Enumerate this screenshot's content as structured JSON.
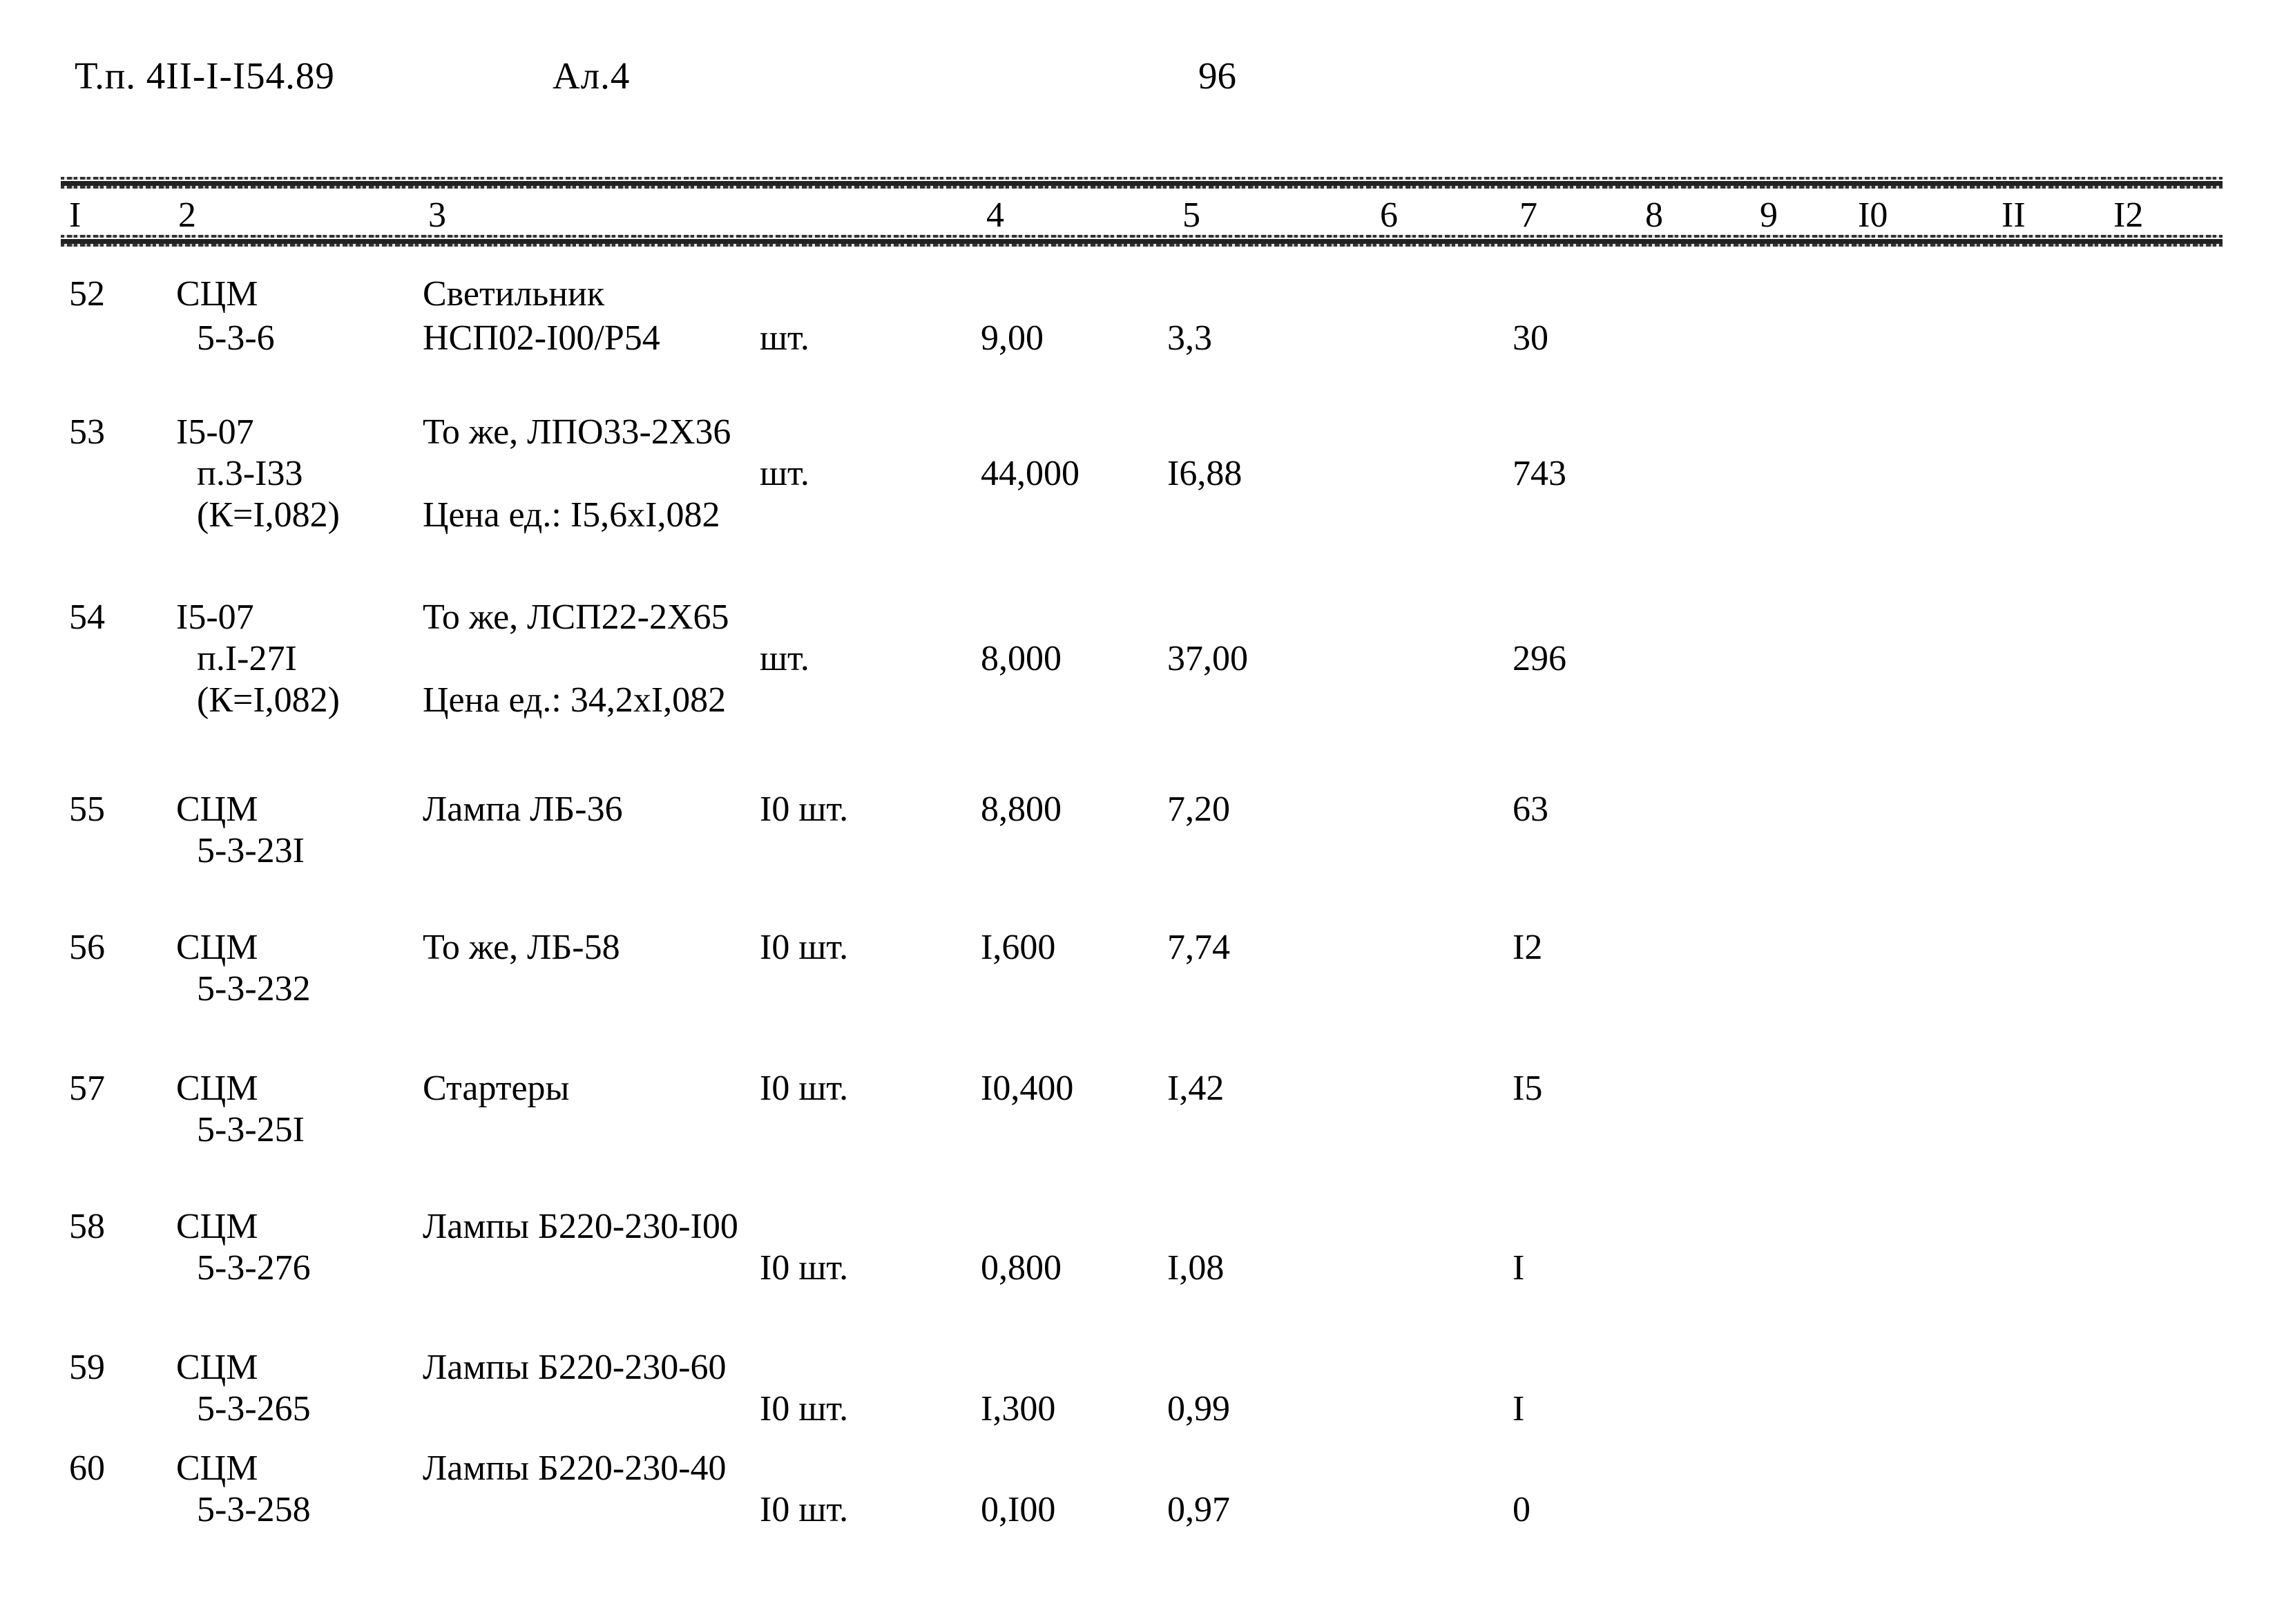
{
  "header": {
    "doc_code": "Т.п. 4II-I-I54.89",
    "album": "Ал.4",
    "page_number": "96"
  },
  "table": {
    "column_headers": [
      "I",
      "2",
      "3",
      "4",
      "5",
      "6",
      "7",
      "8",
      "9",
      "I0",
      "II",
      "I2"
    ],
    "rows": [
      {
        "num": "52",
        "code_line1": "СЦМ",
        "code_line2": "5-3-6",
        "code_line3": "",
        "name_line1": "Светильник",
        "name_line2": "НСП02-I00/Р54",
        "name_line3": "",
        "unit": "шт.",
        "qty": "9,00",
        "price": "3,3",
        "total": "30"
      },
      {
        "num": "53",
        "code_line1": "I5-07",
        "code_line2": "п.3-I33",
        "code_line3": "(К=I,082)",
        "name_line1": "То же, ЛПО33-2Х36",
        "name_line2": "",
        "name_line3": "Цена ед.: I5,6хI,082",
        "unit": "шт.",
        "qty": "44,000",
        "price": "I6,88",
        "total": "743"
      },
      {
        "num": "54",
        "code_line1": "I5-07",
        "code_line2": "п.I-27I",
        "code_line3": "(К=I,082)",
        "name_line1": "То же, ЛСП22-2Х65",
        "name_line2": "",
        "name_line3": "Цена ед.: 34,2хI,082",
        "unit": "шт.",
        "qty": "8,000",
        "price": "37,00",
        "total": "296"
      },
      {
        "num": "55",
        "code_line1": "СЦМ",
        "code_line2": "5-3-23I",
        "code_line3": "",
        "name_line1": "Лампа ЛБ-36",
        "name_line2": "",
        "name_line3": "",
        "unit": "I0 шт.",
        "qty": "8,800",
        "price": "7,20",
        "total": "63"
      },
      {
        "num": "56",
        "code_line1": "СЦМ",
        "code_line2": "5-3-232",
        "code_line3": "",
        "name_line1": "То же, ЛБ-58",
        "name_line2": "",
        "name_line3": "",
        "unit": "I0 шт.",
        "qty": "I,600",
        "price": "7,74",
        "total": "I2"
      },
      {
        "num": "57",
        "code_line1": "СЦМ",
        "code_line2": "5-3-25I",
        "code_line3": "",
        "name_line1": "Стартеры",
        "name_line2": "",
        "name_line3": "",
        "unit": "I0 шт.",
        "qty": "I0,400",
        "price": "I,42",
        "total": "I5"
      },
      {
        "num": "58",
        "code_line1": "СЦМ",
        "code_line2": "5-3-276",
        "code_line3": "",
        "name_line1": "Лампы Б220-230-I00",
        "name_line2": "",
        "name_line3": "",
        "unit": "I0 шт.",
        "qty": "0,800",
        "price": "I,08",
        "total": "I"
      },
      {
        "num": "59",
        "code_line1": "СЦМ",
        "code_line2": "5-3-265",
        "code_line3": "",
        "name_line1": "Лампы Б220-230-60",
        "name_line2": "",
        "name_line3": "",
        "unit": "I0 шт.",
        "qty": "I,300",
        "price": "0,99",
        "total": "I"
      },
      {
        "num": "60",
        "code_line1": "СЦМ",
        "code_line2": "5-3-258",
        "code_line3": "",
        "name_line1": "Лампы Б220-230-40",
        "name_line2": "",
        "name_line3": "",
        "unit": "I0 шт.",
        "qty": "0,I00",
        "price": "0,97",
        "total": "0"
      }
    ]
  }
}
